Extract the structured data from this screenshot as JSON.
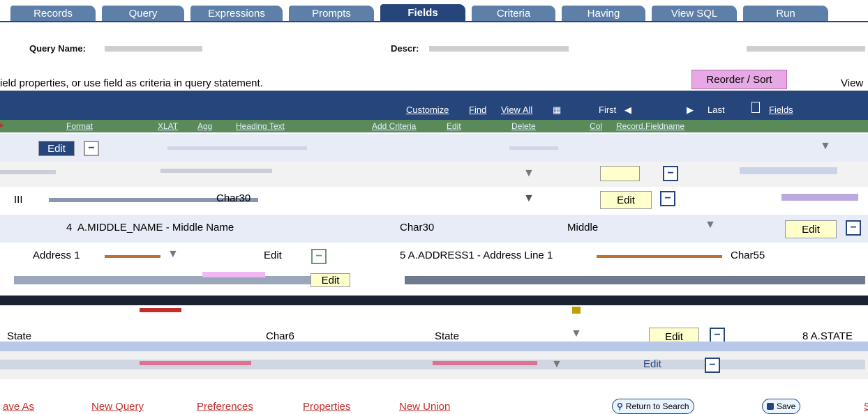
{
  "tabs": [
    {
      "label": "Records"
    },
    {
      "label": "Query"
    },
    {
      "label": "Expressions"
    },
    {
      "label": "Prompts"
    },
    {
      "label": "Fields",
      "active": true
    },
    {
      "label": "Criteria"
    },
    {
      "label": "Having"
    },
    {
      "label": "View SQL"
    },
    {
      "label": "Run"
    }
  ],
  "query_info": {
    "name_label": "Query Name:",
    "desc_label": "Descr:"
  },
  "instructions": "ield properties, or use field as criteria in query statement.",
  "reorder_label": "Reorder / Sort",
  "view_label": "View",
  "nav": {
    "customize": "Customize",
    "find": "Find",
    "view_all": "View All",
    "first": "First",
    "last": "Last",
    "fields": "Fields"
  },
  "head_row": {
    "format": "Format",
    "xlat": "XLAT",
    "agg": "Agg",
    "heading_text": "Heading Text",
    "add_criteria": "Add Criteria",
    "edit": "Edit",
    "delete": "Delete",
    "col": "Col",
    "record_field": "Record.Fieldname"
  },
  "rows": [
    {
      "col": "Edit"
    },
    {
      "text": ""
    },
    {
      "text": "Char30",
      "edit": "Edit"
    },
    {
      "num": "4",
      "field": "A.MIDDLE_NAME - Middle Name",
      "format": "Char30",
      "heading": "Middle",
      "edit": "Edit"
    },
    {
      "heading_left": "Address 1",
      "edit": "Edit",
      "num_field": "5 A.ADDRESS1 - Address Line 1",
      "format": "Char55"
    },
    {
      "edit": "Edit"
    },
    {
      "heading": "State",
      "format": "Char6",
      "heading2": "State",
      "edit": "Edit",
      "num_field": "8 A.STATE"
    },
    {
      "edit": "Edit"
    }
  ],
  "bottom_links": [
    "ave As",
    "New Query",
    "Preferences",
    "Properties",
    "New Union"
  ],
  "buttons": {
    "return": "Return to Search",
    "save": "Save"
  },
  "bottom_tail": "S",
  "colors": {
    "tab": "#5d7fa8",
    "tab_active": "#26457a",
    "navbar": "#26457a",
    "link": "#c0302b",
    "edit_bg": "#ffffcc",
    "row_bg": "#e7ecf7"
  }
}
